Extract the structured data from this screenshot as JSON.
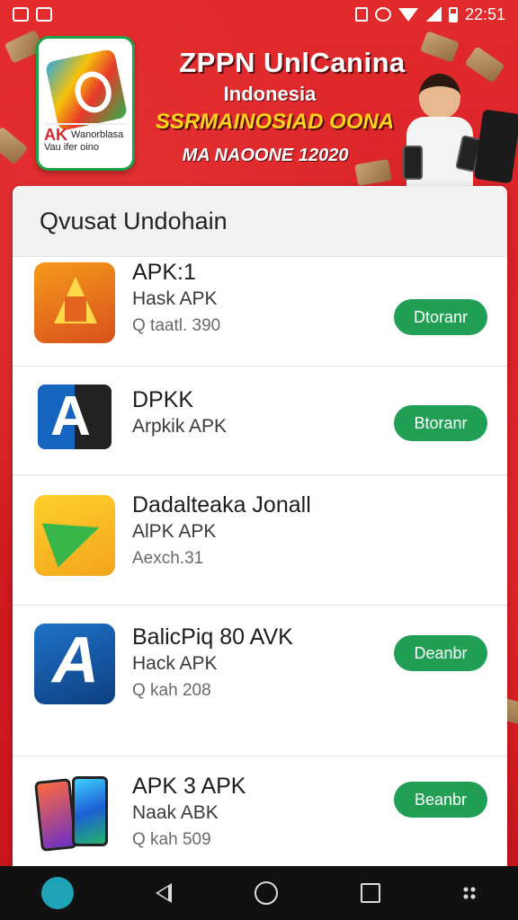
{
  "status_bar": {
    "time": "22:51"
  },
  "banner": {
    "logo_caption_mark": "AK",
    "logo_caption_line1": "Wanorblasa",
    "logo_caption_line2": "Vau ifer oino",
    "title": "ZPPN UnlCanina",
    "subtitle": "Indonesia",
    "highlight": "SSRMAINOSIAD OONA",
    "date_line": "MA NAOONE 12020"
  },
  "list": {
    "header": "Qvusat Undohain",
    "items": [
      {
        "name": "APK:1",
        "type": "Hask APK",
        "size": "Q taatl. 390",
        "button": "Dtoranr"
      },
      {
        "name": "DPKK",
        "type": "Arpkik APK",
        "size": "",
        "button": "Btoranr"
      },
      {
        "name": "Dadalteaka Jonall",
        "type": "AlPK APK",
        "size": "Aexch.31",
        "button": ""
      },
      {
        "name": "BalicPiq 80 AVK",
        "type": "Hack APK",
        "size": "Q kah 208",
        "button": "Deanbr"
      },
      {
        "name": "APK 3 APK",
        "type": "Naak ABK",
        "size": "Q kah 509",
        "button": "Beanbr"
      }
    ]
  },
  "colors": {
    "accent_red": "#d81f26",
    "button_green": "#21a055",
    "highlight_yellow": "#ffd21c"
  },
  "icons": {
    "item_icons": [
      "orange-a-app-icon",
      "apk-a-app-icon",
      "green-arrow-app-icon",
      "blue-a-apk-icon",
      "phones-app-icon"
    ]
  }
}
